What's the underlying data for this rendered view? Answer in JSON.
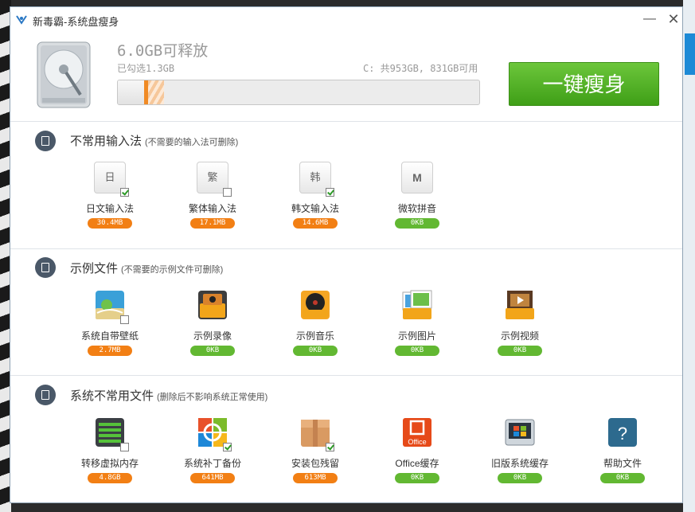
{
  "window": {
    "title": "新毒霸-系统盘瘦身",
    "minimize_glyph": "—",
    "close_glyph": "✕"
  },
  "header": {
    "free_space": "6.0GB可释放",
    "selected": "已勾选1.3GB",
    "disk_info": "C: 共953GB, 831GB可用",
    "button_label": "一键瘦身",
    "progress_fraction": 0.083
  },
  "sections": [
    {
      "title": "不常用输入法",
      "subtitle": "(不需要的输入法可删除)",
      "items": [
        {
          "name": "日文输入法",
          "size": "30.4MB",
          "checked": true,
          "icon": "日",
          "badge": "orange"
        },
        {
          "name": "繁体输入法",
          "size": "17.1MB",
          "checked": false,
          "icon": "繁",
          "badge": "orange"
        },
        {
          "name": "韩文输入法",
          "size": "14.6MB",
          "checked": true,
          "icon": "韩",
          "badge": "orange"
        },
        {
          "name": "微软拼音",
          "size": "0KB",
          "checked": null,
          "icon": "M",
          "badge": "green"
        }
      ]
    },
    {
      "title": "示例文件",
      "subtitle": "(不需要的示例文件可删除)",
      "items": [
        {
          "name": "系统自带壁纸",
          "size": "2.7MB",
          "checked": false,
          "icon": "wallpaper-icon",
          "badge": "orange"
        },
        {
          "name": "示例录像",
          "size": "0KB",
          "checked": null,
          "icon": "video-recording-icon",
          "badge": "green"
        },
        {
          "name": "示例音乐",
          "size": "0KB",
          "checked": null,
          "icon": "music-icon",
          "badge": "green"
        },
        {
          "name": "示例图片",
          "size": "0KB",
          "checked": null,
          "icon": "pictures-icon",
          "badge": "green"
        },
        {
          "name": "示例视频",
          "size": "0KB",
          "checked": null,
          "icon": "video-icon",
          "badge": "green"
        }
      ]
    },
    {
      "title": "系统不常用文件",
      "subtitle": "(删除后不影响系统正常使用)",
      "items": [
        {
          "name": "转移虚拟内存",
          "size": "4.8GB",
          "checked": false,
          "icon": "memory-icon",
          "badge": "orange"
        },
        {
          "name": "系统补丁备份",
          "size": "641MB",
          "checked": true,
          "icon": "windows-patch-icon",
          "badge": "orange"
        },
        {
          "name": "安装包残留",
          "size": "613MB",
          "checked": true,
          "icon": "package-icon",
          "badge": "orange"
        },
        {
          "name": "Office缓存",
          "size": "0KB",
          "checked": null,
          "icon": "office-icon",
          "badge": "green",
          "icon_text": "Office"
        },
        {
          "name": "旧版系统缓存",
          "size": "0KB",
          "checked": null,
          "icon": "old-windows-icon",
          "badge": "green"
        },
        {
          "name": "帮助文件",
          "size": "0KB",
          "checked": null,
          "icon": "help-icon",
          "badge": "green",
          "icon_text": "?"
        }
      ]
    }
  ],
  "colors": {
    "accent_green": "#4caf25",
    "badge_orange": "#f27f14",
    "badge_green": "#62b832"
  }
}
